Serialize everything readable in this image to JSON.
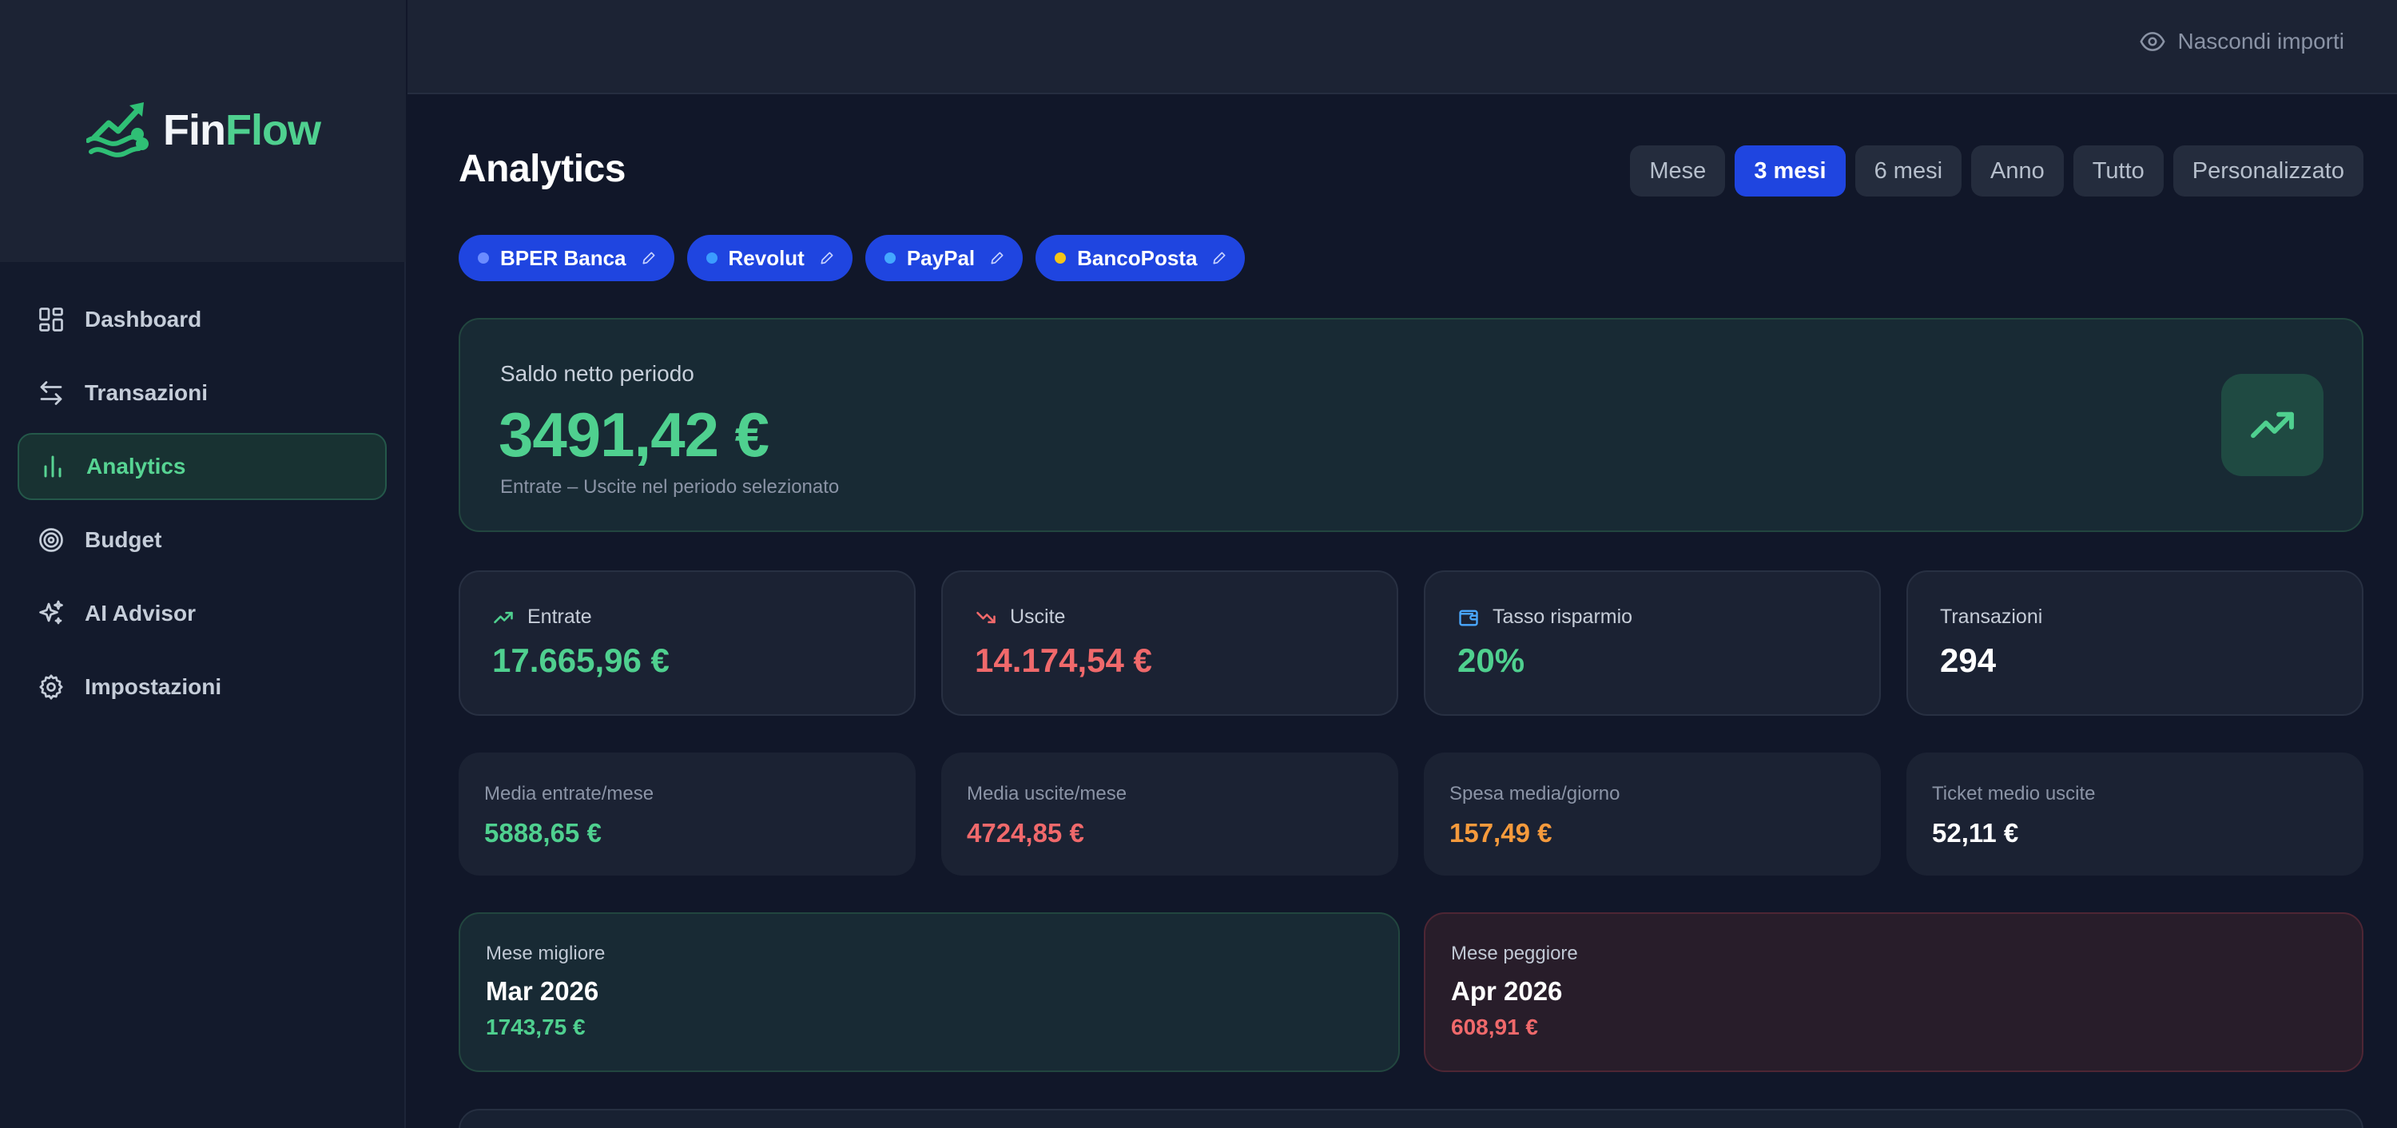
{
  "brand": {
    "name_part1": "Fin",
    "name_part2": "Flow",
    "icon": "finflow-logo"
  },
  "sidebar": {
    "items": [
      {
        "label": "Dashboard",
        "icon": "dashboard-grid-icon",
        "active": false
      },
      {
        "label": "Transazioni",
        "icon": "arrows-exchange-icon",
        "active": false
      },
      {
        "label": "Analytics",
        "icon": "bar-chart-icon",
        "active": true
      },
      {
        "label": "Budget",
        "icon": "target-icon",
        "active": false
      },
      {
        "label": "AI Advisor",
        "icon": "sparkles-icon",
        "active": false
      },
      {
        "label": "Impostazioni",
        "icon": "gear-icon",
        "active": false
      }
    ]
  },
  "topbar": {
    "hide_amounts_label": "Nascondi importi",
    "hide_amounts_icon": "eye-icon"
  },
  "page": {
    "title": "Analytics"
  },
  "periods": {
    "options": [
      "Mese",
      "3 mesi",
      "6 mesi",
      "Anno",
      "Tutto",
      "Personalizzato"
    ],
    "selected": "3 mesi"
  },
  "accounts": [
    {
      "name": "BPER Banca",
      "dot_color": "#6b8cff"
    },
    {
      "name": "Revolut",
      "dot_color": "#3b9cff"
    },
    {
      "name": "PayPal",
      "dot_color": "#44a8ff"
    },
    {
      "name": "BancoPosta",
      "dot_color": "#f5c518"
    }
  ],
  "summary": {
    "label": "Saldo netto periodo",
    "value": "3491,42 €",
    "subtitle": "Entrate – Uscite nel periodo selezionato",
    "icon": "trending-up-icon"
  },
  "stats": [
    {
      "label": "Entrate",
      "value": "17.665,96 €",
      "icon": "trending-up-icon",
      "color": "#4fd08f"
    },
    {
      "label": "Uscite",
      "value": "14.174,54 €",
      "icon": "trending-down-icon",
      "color": "#f0696b"
    },
    {
      "label": "Tasso risparmio",
      "value": "20%",
      "icon": "wallet-icon",
      "color": "#4fd08f"
    },
    {
      "label": "Transazioni",
      "value": "294",
      "icon": "",
      "color": "#ffffff"
    }
  ],
  "averages": [
    {
      "label": "Media entrate/mese",
      "value": "5888,65 €",
      "color": "#4fd08f"
    },
    {
      "label": "Media uscite/mese",
      "value": "4724,85 €",
      "color": "#f0696b"
    },
    {
      "label": "Spesa media/giorno",
      "value": "157,49 €",
      "color": "#f59a3c"
    },
    {
      "label": "Ticket medio uscite",
      "value": "52,11 €",
      "color": "#ffffff"
    }
  ],
  "best_month": {
    "label": "Mese migliore",
    "month": "Mar 2026",
    "value": "1743,75 €",
    "color": "#4fd08f"
  },
  "worst_month": {
    "label": "Mese peggiore",
    "month": "Apr 2026",
    "value": "608,91 €",
    "color": "#f0696b"
  },
  "colors": {
    "accent_green": "#4fd08f",
    "accent_red": "#f0696b",
    "accent_orange": "#f59a3c",
    "accent_blue": "#1f45e0"
  }
}
